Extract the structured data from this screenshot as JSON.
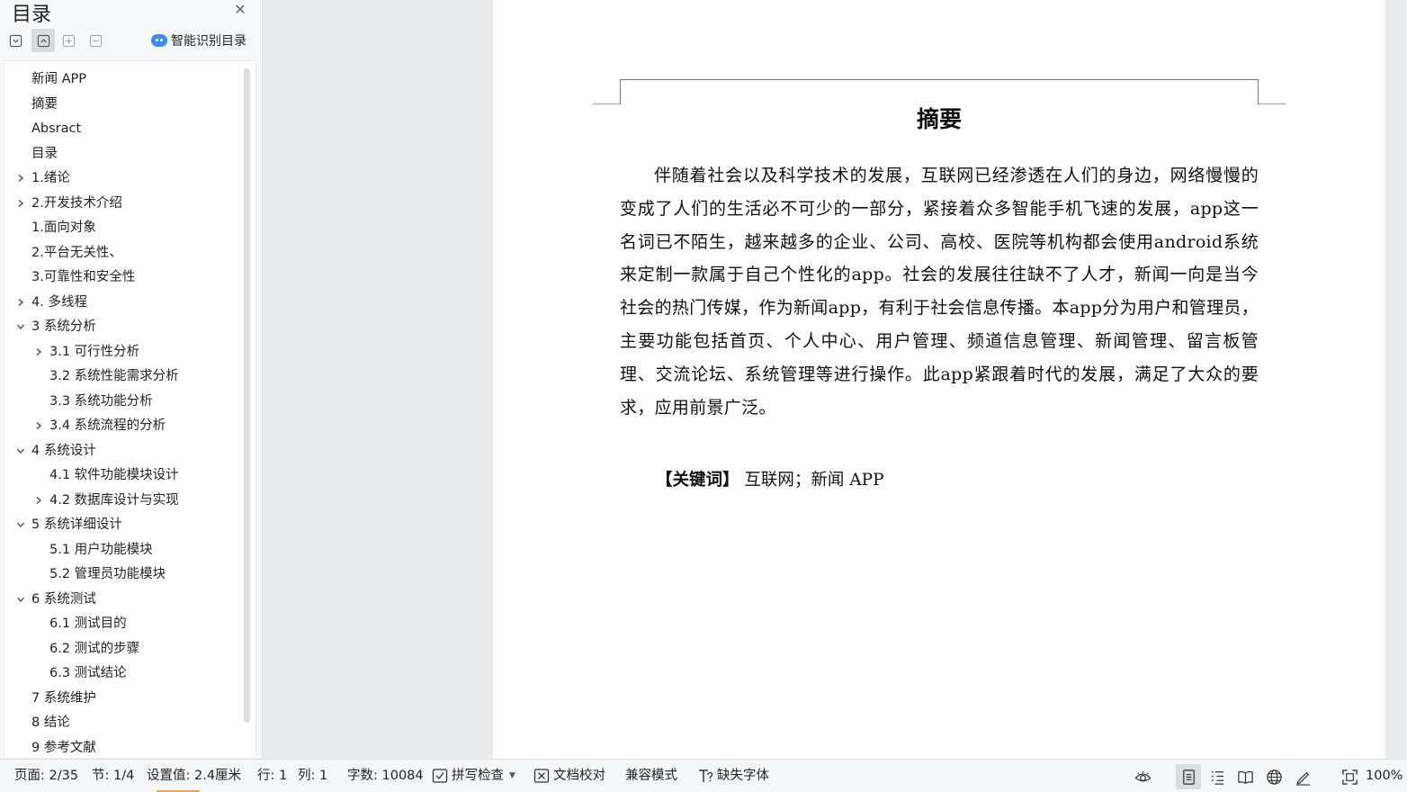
{
  "sidebar": {
    "title": "目录",
    "smart_toc_label": "智能识别目录",
    "toolbar_icons": [
      "expand-all-icon",
      "collapse-all-icon",
      "add-level-icon",
      "remove-level-icon"
    ]
  },
  "toc": [
    {
      "label": "新闻 APP",
      "level": 0,
      "arrow": "none"
    },
    {
      "label": "摘要",
      "level": 0,
      "arrow": "none"
    },
    {
      "label": "Absract",
      "level": 0,
      "arrow": "none"
    },
    {
      "label": "目录",
      "level": 0,
      "arrow": "none"
    },
    {
      "label": "1.绪论",
      "level": 0,
      "arrow": "right"
    },
    {
      "label": "2.开发技术介绍",
      "level": 0,
      "arrow": "right"
    },
    {
      "label": "1.面向对象",
      "level": 0,
      "arrow": "none"
    },
    {
      "label": "2.平台无关性、",
      "level": 0,
      "arrow": "none"
    },
    {
      "label": "3.可靠性和安全性",
      "level": 0,
      "arrow": "none"
    },
    {
      "label": "4.  多线程",
      "level": 0,
      "arrow": "right"
    },
    {
      "label": "3 系统分析",
      "level": 0,
      "arrow": "down"
    },
    {
      "label": "3.1 可行性分析",
      "level": 1,
      "arrow": "right"
    },
    {
      "label": "3.2 系统性能需求分析",
      "level": 1,
      "arrow": "none"
    },
    {
      "label": "3.3 系统功能分析",
      "level": 1,
      "arrow": "none"
    },
    {
      "label": "3.4 系统流程的分析",
      "level": 1,
      "arrow": "right"
    },
    {
      "label": "4 系统设计",
      "level": 0,
      "arrow": "down"
    },
    {
      "label": "4.1  软件功能模块设计",
      "level": 1,
      "arrow": "none"
    },
    {
      "label": "4.2  数据库设计与实现",
      "level": 1,
      "arrow": "right"
    },
    {
      "label": "5  系统详细设计",
      "level": 0,
      "arrow": "down"
    },
    {
      "label": "5.1 用户功能模块",
      "level": 1,
      "arrow": "none"
    },
    {
      "label": "5.2 管理员功能模块",
      "level": 1,
      "arrow": "none"
    },
    {
      "label": "6  系统测试",
      "level": 0,
      "arrow": "down"
    },
    {
      "label": "6.1  测试目的",
      "level": 1,
      "arrow": "none"
    },
    {
      "label": "6.2  测试的步骤",
      "level": 1,
      "arrow": "none"
    },
    {
      "label": "6.3 测试结论",
      "level": 1,
      "arrow": "none"
    },
    {
      "label": "7  系统维护",
      "level": 0,
      "arrow": "none"
    },
    {
      "label": "8  结论",
      "level": 0,
      "arrow": "none"
    },
    {
      "label": "9  参考文献",
      "level": 0,
      "arrow": "none"
    }
  ],
  "document": {
    "heading": "摘要",
    "body": "伴随着社会以及科学技术的发展，互联网已经渗透在人们的身边，网络慢慢的变成了人们的生活必不可少的一部分，紧接着众多智能手机飞速的发展，app这一名词已不陌生，越来越多的企业、公司、高校、医院等机构都会使用android系统来定制一款属于自己个性化的app。社会的发展往往缺不了人才，新闻一向是当今社会的热门传媒，作为新闻app，有利于社会信息传播。本app分为用户和管理员，主要功能包括首页、个人中心、用户管理、频道信息管理、新闻管理、留言板管理、交流论坛、系统管理等进行操作。此app紧跟着时代的发展，满足了大众的要求，应用前景广泛。",
    "keywords_label": "【关键词】",
    "keywords": "互联网；新闻 APP"
  },
  "statusbar": {
    "page": "页面: 2/35",
    "section": "节: 1/4",
    "setting": "设置值: 2.4厘米",
    "row": "行: 1",
    "col": "列: 1",
    "word_count": "字数: 10084",
    "spell_check": "拼写检查",
    "proofread": "文档校对",
    "compat_mode": "兼容模式",
    "missing_fonts": "缺失字体",
    "zoom": "100%",
    "view_icons": [
      "eye-protection-icon",
      "page-view-icon",
      "outline-view-icon",
      "reading-view-icon",
      "web-view-icon",
      "write-mode-icon",
      "fit-page-icon"
    ]
  },
  "colors": {
    "accent": "#3a8df5",
    "page_indicator": "#f0a34a"
  }
}
